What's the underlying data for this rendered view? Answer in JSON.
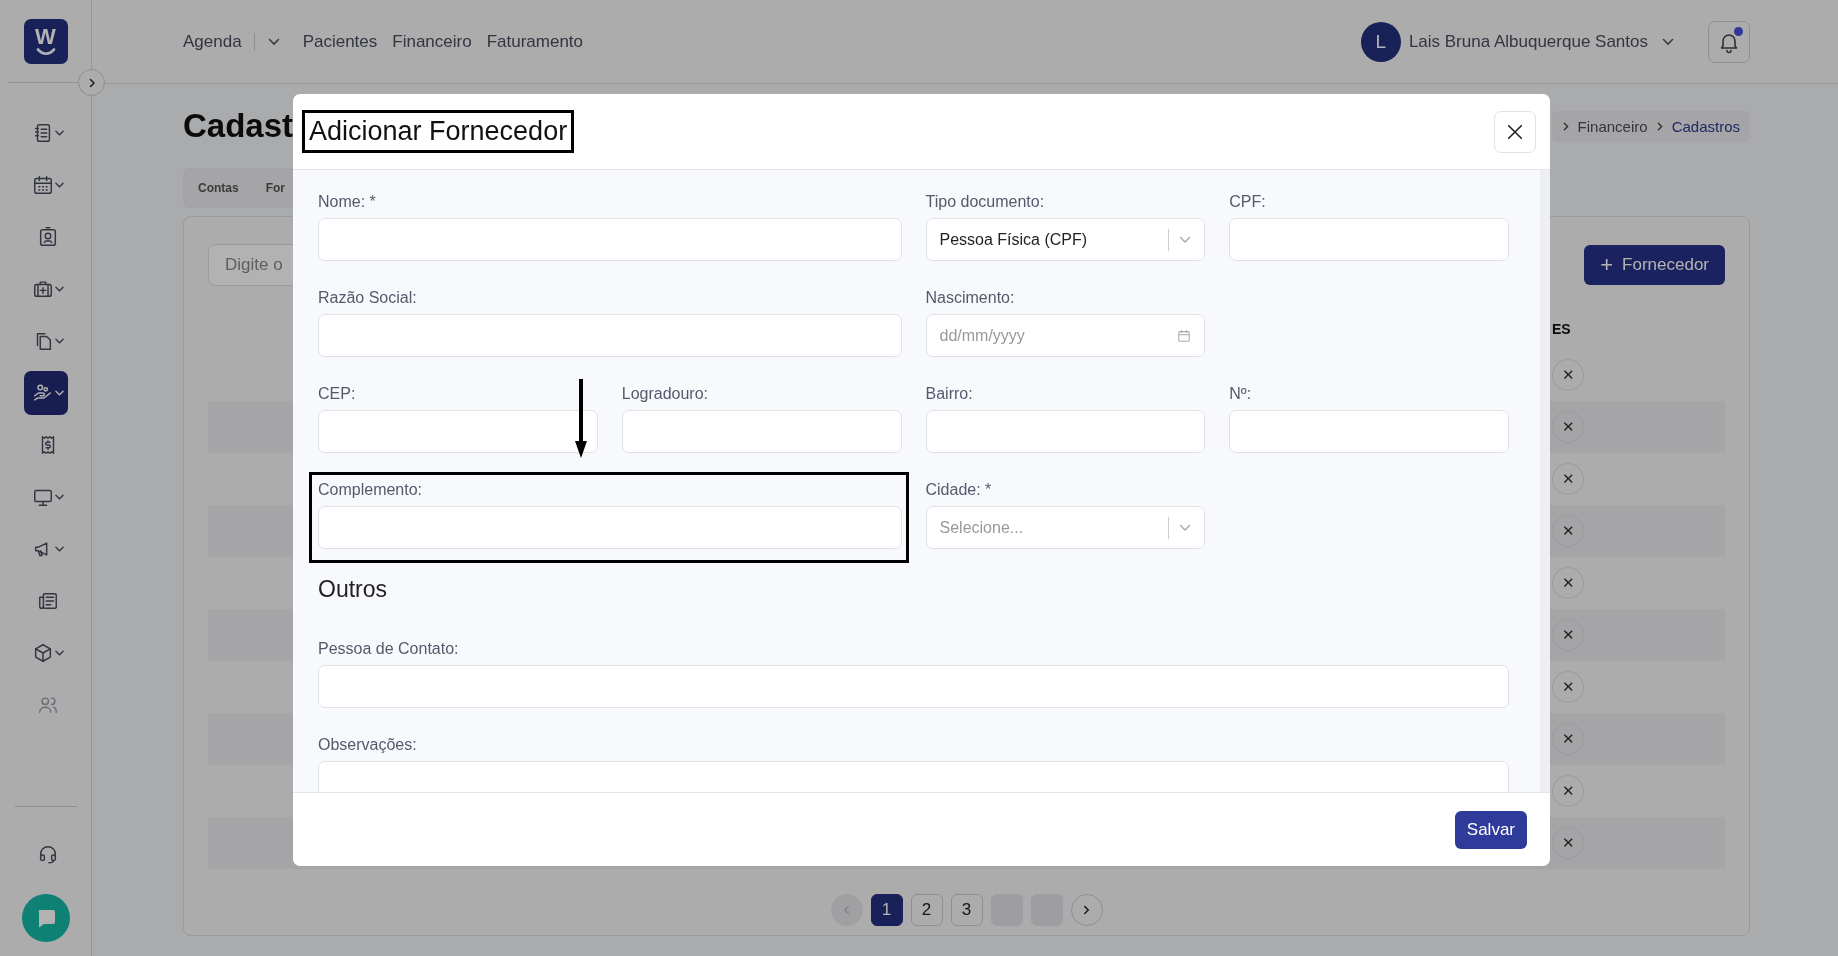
{
  "sidebar": {
    "logo_text": "W",
    "items": [
      {
        "dropdown": true,
        "selected": false,
        "disabled": false
      },
      {
        "dropdown": true,
        "selected": false,
        "disabled": false
      },
      {
        "dropdown": false,
        "selected": false,
        "disabled": false
      },
      {
        "dropdown": true,
        "selected": false,
        "disabled": false
      },
      {
        "dropdown": true,
        "selected": false,
        "disabled": false
      },
      {
        "dropdown": true,
        "selected": true,
        "disabled": false
      },
      {
        "dropdown": false,
        "selected": false,
        "disabled": false
      },
      {
        "dropdown": true,
        "selected": false,
        "disabled": false
      },
      {
        "dropdown": true,
        "selected": false,
        "disabled": false
      },
      {
        "dropdown": false,
        "selected": false,
        "disabled": false
      },
      {
        "dropdown": true,
        "selected": false,
        "disabled": false
      },
      {
        "dropdown": false,
        "selected": false,
        "disabled": true
      }
    ]
  },
  "header": {
    "nav": [
      {
        "kind": "link",
        "label": "Agenda"
      },
      {
        "kind": "menu_toggle"
      },
      {
        "kind": "link",
        "label": "Pacientes"
      },
      {
        "kind": "link",
        "label": "Financeiro"
      },
      {
        "kind": "link",
        "label": "Faturamento"
      }
    ],
    "user": {
      "initial": "L",
      "name": "Lais Bruna Albuquerque Santos"
    },
    "notifications": {
      "unread": true
    }
  },
  "page": {
    "title": "Cadast",
    "breadcrumb": [
      "Financeiro",
      "Cadastros"
    ],
    "tabs": [
      "Contas",
      "For"
    ],
    "search": {
      "placeholder": "Digite o"
    },
    "add_button": {
      "icon": "+",
      "label": "Fornecedor"
    },
    "table": {
      "column_heading": "ES",
      "rows": [
        {
          "action": "✕"
        },
        {
          "action": "✕"
        },
        {
          "action": "✕"
        },
        {
          "action": "✕"
        },
        {
          "action": "✕"
        },
        {
          "action": "✕"
        },
        {
          "action": "✕"
        },
        {
          "action": "✕"
        },
        {
          "action": "✕"
        },
        {
          "action": "✕"
        }
      ]
    },
    "pagination": [
      {
        "kind": "prev",
        "disabled": true
      },
      {
        "kind": "page",
        "label": "1",
        "selected": true
      },
      {
        "kind": "page",
        "label": "2",
        "selected": false
      },
      {
        "kind": "page",
        "label": "3",
        "selected": false
      },
      {
        "kind": "blank"
      },
      {
        "kind": "blank"
      },
      {
        "kind": "next",
        "disabled": false
      }
    ]
  },
  "modal": {
    "title": "Adicionar Fornecedor",
    "title_highlighted": true,
    "groups": [
      {
        "rows": [
          [
            {
              "kind": "text",
              "label": "Nome: *",
              "annotated": false
            },
            "",
            {
              "kind": "select",
              "label": "Tipo documento:",
              "value": "Pessoa Física (CPF)",
              "annotated": false
            },
            {
              "kind": "text",
              "label": "CPF:",
              "annotated": false
            }
          ],
          [
            {
              "kind": "text",
              "label": "Razão Social:",
              "annotated": false
            },
            "",
            {
              "kind": "date",
              "label": "Nascimento:",
              "placeholder": "dd/mm/yyyy",
              "annotated": false
            }
          ],
          [
            {
              "kind": "text",
              "label": "CEP:",
              "annotated": false
            },
            {
              "kind": "text",
              "label": "Logradouro:",
              "annotated": false
            },
            {
              "kind": "text",
              "label": "Bairro:",
              "annotated": false
            },
            {
              "kind": "text",
              "label": "Nº:",
              "annotated": false
            }
          ],
          [
            {
              "kind": "text",
              "label": "Complemento:",
              "annotated": true
            },
            "",
            {
              "kind": "select",
              "label": "Cidade: *",
              "placeholder": "Selecione...",
              "annotated": false
            }
          ]
        ]
      },
      {
        "heading": "Outros",
        "rows": [
          [
            {
              "kind": "text",
              "label": "Pessoa de Contato:",
              "annotated": false
            },
            "",
            "",
            ""
          ],
          [
            {
              "kind": "text",
              "label": "Observações:",
              "annotated": false
            },
            "",
            "",
            ""
          ]
        ]
      }
    ],
    "save_button": "Salvar"
  }
}
